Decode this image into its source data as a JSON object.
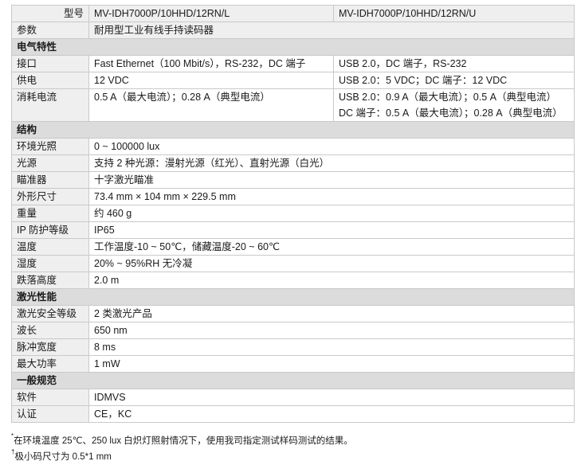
{
  "header": {
    "model_label": "型号",
    "model_l": "MV-IDH7000P/10HHD/12RN/L",
    "model_u": "MV-IDH7000P/10HHD/12RN/U",
    "param_label": "参数",
    "param_value": "耐用型工业有线手持读码器"
  },
  "sections": [
    {
      "title": "电气特性",
      "rows": [
        {
          "label": "接口",
          "l": "Fast Ethernet（100 Mbit/s），RS-232，DC 端子",
          "u": [
            "USB 2.0，DC 端子，RS-232"
          ]
        },
        {
          "label": "供电",
          "l": "12 VDC",
          "u": [
            "USB 2.0：5 VDC；DC 端子：12 VDC"
          ]
        },
        {
          "label": "消耗电流",
          "l": "0.5 A（最大电流）；0.28 A（典型电流）",
          "u": [
            "USB 2.0：0.9 A（最大电流）；0.5 A（典型电流）",
            "DC 端子：0.5 A（最大电流）；0.28 A（典型电流）"
          ]
        }
      ]
    },
    {
      "title": "结构",
      "rows": [
        {
          "label": "环境光照",
          "value": "0 ~ 100000 lux"
        },
        {
          "label": "光源",
          "value": "支持 2 种光源：漫射光源（红光）、直射光源（白光）"
        },
        {
          "label": "瞄准器",
          "value": "十字激光瞄准"
        },
        {
          "label": "外形尺寸",
          "value": "73.4 mm × 104 mm × 229.5 mm"
        },
        {
          "label": "重量",
          "value": "约 460 g"
        },
        {
          "label": "IP 防护等级",
          "value": "IP65"
        },
        {
          "label": "温度",
          "value": "工作温度-10 ~ 50℃，储藏温度-20 ~ 60℃"
        },
        {
          "label": "湿度",
          "value": "20% ~ 95%RH 无冷凝"
        },
        {
          "label": "跌落高度",
          "value": "2.0 m"
        }
      ]
    },
    {
      "title": "激光性能",
      "rows": [
        {
          "label": "激光安全等级",
          "value": "2 类激光产品"
        },
        {
          "label": "波长",
          "value": "650 nm"
        },
        {
          "label": "脉冲宽度",
          "value": "8 ms"
        },
        {
          "label": "最大功率",
          "value": "1 mW"
        }
      ]
    },
    {
      "title": "一般规范",
      "rows": [
        {
          "label": "软件",
          "value": "IDMVS"
        },
        {
          "label": "认证",
          "value": "CE，KC"
        }
      ]
    }
  ],
  "footnotes": [
    {
      "mark": "*",
      "text": "在环境温度 25℃、250 lux 白炽灯照射情况下，使用我司指定测试样码测试的结果。"
    },
    {
      "mark": "†",
      "text": "极小码尺寸为 0.5*1 mm"
    }
  ]
}
